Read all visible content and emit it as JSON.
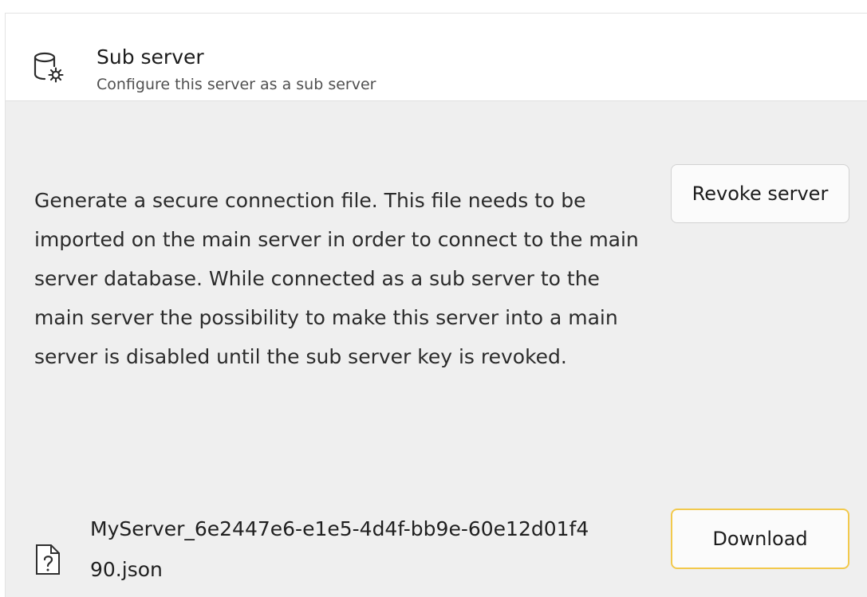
{
  "header": {
    "icon": "database-gear-icon",
    "title": "Sub server",
    "subtitle": "Configure this server as a sub server"
  },
  "body": {
    "description": "Generate a secure connection file. This file needs to be imported on the main server in order to connect to the main server database. While connected as a sub server to the main server the possibility to make this server into a main server is disabled until the sub server key is revoked.",
    "revoke_label": "Revoke server"
  },
  "file": {
    "icon": "unknown-file-icon",
    "name": "MyServer_6e2447e6-e1e5-4d4f-bb9e-60e12d01f490.json",
    "download_label": "Download"
  },
  "colors": {
    "panel_background": "#efefef",
    "header_background": "#ffffff",
    "download_focus_border": "#f2c94c"
  }
}
